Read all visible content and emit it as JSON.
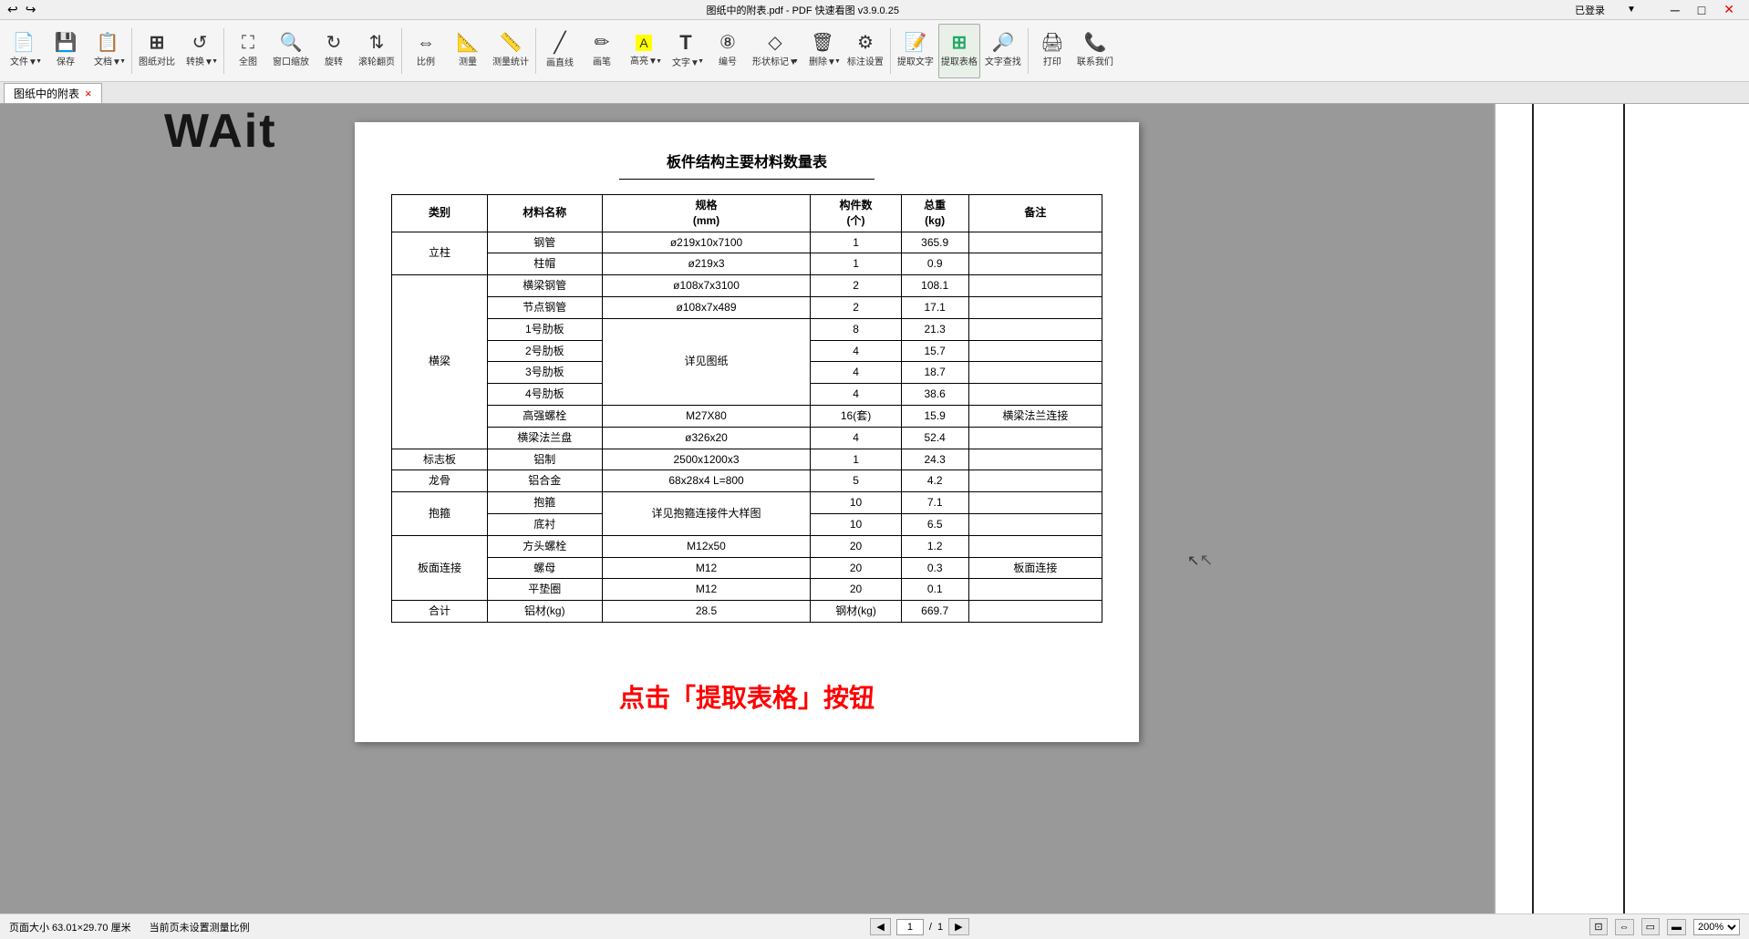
{
  "titleBar": {
    "title": "图纸中的附表.pdf - PDF 快速看图 v3.9.0.25",
    "userLabel": "已登录",
    "minBtn": "─",
    "maxBtn": "□",
    "closeBtn": "✕"
  },
  "toolbar": {
    "buttons": [
      {
        "id": "file",
        "icon": "icon-file",
        "label": "文件▼"
      },
      {
        "id": "save",
        "icon": "icon-save",
        "label": "保存"
      },
      {
        "id": "doc",
        "icon": "icon-doc",
        "label": "文档▼"
      },
      {
        "id": "compare",
        "icon": "icon-compare",
        "label": "图纸对比"
      },
      {
        "id": "rotate",
        "icon": "icon-rotate2",
        "label": "转换▼"
      },
      {
        "id": "fullscreen",
        "icon": "icon-fullscreen",
        "label": "全图"
      },
      {
        "id": "zoom-win",
        "icon": "icon-zoom-win",
        "label": "窗口缩放"
      },
      {
        "id": "rotate2",
        "icon": "icon-rotate",
        "label": "旋转"
      },
      {
        "id": "scroll",
        "icon": "icon-scroll",
        "label": "滚轮翻页"
      },
      {
        "id": "scale",
        "icon": "icon-scale",
        "label": "比例"
      },
      {
        "id": "measure",
        "icon": "icon-measure",
        "label": "测量"
      },
      {
        "id": "measure2",
        "icon": "icon-measure2",
        "label": "测量统计"
      },
      {
        "id": "line",
        "icon": "icon-line",
        "label": "画直线"
      },
      {
        "id": "pen",
        "icon": "icon-pen",
        "label": "画笔"
      },
      {
        "id": "eraser",
        "icon": "icon-eraser",
        "label": "高亮▼"
      },
      {
        "id": "text",
        "icon": "icon-text",
        "label": "文字▼"
      },
      {
        "id": "number",
        "icon": "icon-number",
        "label": "编号"
      },
      {
        "id": "shape",
        "icon": "icon-shape",
        "label": "形状标记▼"
      },
      {
        "id": "erase2",
        "icon": "icon-erase2",
        "label": "删除▼"
      },
      {
        "id": "mark",
        "icon": "icon-mark",
        "label": "标注设置"
      },
      {
        "id": "extract-text",
        "icon": "icon-extract-text",
        "label": "提取文字"
      },
      {
        "id": "extract-table",
        "icon": "icon-extract-table",
        "label": "提取表格"
      },
      {
        "id": "find-text",
        "icon": "icon-find-text",
        "label": "文字查找"
      },
      {
        "id": "print",
        "icon": "icon-print",
        "label": "打印"
      },
      {
        "id": "connect",
        "icon": "icon-connect",
        "label": "联系我们"
      }
    ]
  },
  "tab": {
    "label": "图纸中的附表",
    "closeBtn": "×"
  },
  "pdf": {
    "pageTitle": "板件结构主要材料数量表",
    "table": {
      "headers": [
        "类别",
        "材料名称",
        "规格\n(mm)",
        "构件数\n(个)",
        "总重\n(kg)",
        "备注"
      ],
      "rows": [
        {
          "category": "立柱",
          "rowspan": 2,
          "items": [
            {
              "name": "钢管",
              "spec": "ø219x10x7100",
              "count": "1",
              "weight": "365.9",
              "note": ""
            },
            {
              "name": "柱帽",
              "spec": "ø219x3",
              "count": "1",
              "weight": "0.9",
              "note": ""
            }
          ]
        },
        {
          "category": "横梁",
          "rowspan": 8,
          "items": [
            {
              "name": "横梁钢管",
              "spec": "ø108x7x3100",
              "count": "2",
              "weight": "108.1",
              "note": ""
            },
            {
              "name": "节点钢管",
              "spec": "ø108x7x489",
              "count": "2",
              "weight": "17.1",
              "note": ""
            },
            {
              "name": "1号肋板",
              "spec": "",
              "count": "8",
              "weight": "21.3",
              "note": ""
            },
            {
              "name": "2号肋板",
              "spec": "详见图纸",
              "count": "4",
              "weight": "15.7",
              "note": ""
            },
            {
              "name": "3号肋板",
              "spec": "",
              "count": "4",
              "weight": "18.7",
              "note": ""
            },
            {
              "name": "4号肋板",
              "spec": "",
              "count": "4",
              "weight": "38.6",
              "note": ""
            },
            {
              "name": "高强螺栓",
              "spec": "M27X80",
              "count": "16(套)",
              "weight": "15.9",
              "note": "横梁法兰连接"
            },
            {
              "name": "横梁法兰盘",
              "spec": "ø326x20",
              "count": "4",
              "weight": "52.4",
              "note": ""
            }
          ]
        },
        {
          "category": "标志板",
          "rowspan": 1,
          "items": [
            {
              "name": "铝制",
              "spec": "2500x1200x3",
              "count": "1",
              "weight": "24.3",
              "note": ""
            }
          ]
        },
        {
          "category": "龙骨",
          "rowspan": 1,
          "items": [
            {
              "name": "铝合金",
              "spec": "68x28x4 L=800",
              "count": "5",
              "weight": "4.2",
              "note": ""
            }
          ]
        },
        {
          "category": "抱箍",
          "rowspan": 2,
          "items": [
            {
              "name": "抱箍",
              "spec": "详见抱箍连接件大样图",
              "count": "10",
              "weight": "7.1",
              "note": ""
            },
            {
              "name": "底衬",
              "spec": "",
              "count": "10",
              "weight": "6.5",
              "note": ""
            }
          ]
        },
        {
          "category": "板面连接",
          "rowspan": 3,
          "items": [
            {
              "name": "方头螺栓",
              "spec": "M12x50",
              "count": "20",
              "weight": "1.2",
              "note": ""
            },
            {
              "name": "螺母",
              "spec": "M12",
              "count": "20",
              "weight": "0.3",
              "note": "板面连接"
            },
            {
              "name": "平垫圈",
              "spec": "M12",
              "count": "20",
              "weight": "0.1",
              "note": ""
            }
          ]
        },
        {
          "category": "合计",
          "rowspan": 1,
          "items": [
            {
              "name": "铝材(kg)",
              "spec": "28.5",
              "count": "钢材(kg)",
              "weight": "669.7",
              "note": ""
            }
          ]
        }
      ]
    },
    "annotation": "点击「提取表格」按钮"
  },
  "waitText": "WAit",
  "statusBar": {
    "pageSize": "页面大小 63.01×29.70 厘米",
    "scaleInfo": "当前页未设置测量比例",
    "pageNav": {
      "current": "1",
      "total": "1"
    },
    "icons": [
      "fit-page",
      "fit-width",
      "single-page",
      "two-page"
    ],
    "zoom": "200%"
  }
}
